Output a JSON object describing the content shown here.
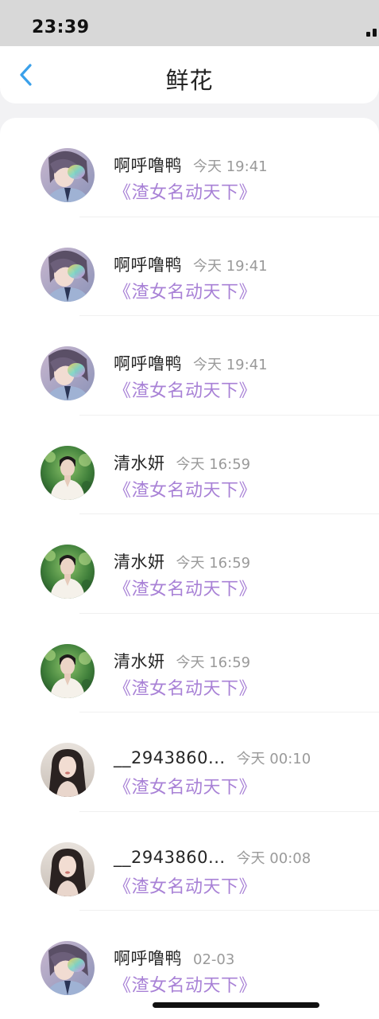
{
  "status_bar": {
    "time": "23:39"
  },
  "header": {
    "title": "鲜花"
  },
  "colors": {
    "accent": "#3aa0ea",
    "book_title": "#a881d6",
    "name": "#262626",
    "time": "#9a9a9a"
  },
  "items": [
    {
      "avatar": "anime-avatar",
      "name": "啊呼噜鸭",
      "time": "今天 19:41",
      "book": "《渣女名动天下》"
    },
    {
      "avatar": "anime-avatar",
      "name": "啊呼噜鸭",
      "time": "今天 19:41",
      "book": "《渣女名动天下》"
    },
    {
      "avatar": "anime-avatar",
      "name": "啊呼噜鸭",
      "time": "今天 19:41",
      "book": "《渣女名动天下》"
    },
    {
      "avatar": "man-photo-avatar",
      "name": "清水妍",
      "time": "今天 16:59",
      "book": "《渣女名动天下》"
    },
    {
      "avatar": "man-photo-avatar",
      "name": "清水妍",
      "time": "今天 16:59",
      "book": "《渣女名动天下》"
    },
    {
      "avatar": "man-photo-avatar",
      "name": "清水妍",
      "time": "今天 16:59",
      "book": "《渣女名动天下》"
    },
    {
      "avatar": "woman-photo-avatar",
      "name": "__2943860...",
      "time": "今天 00:10",
      "book": "《渣女名动天下》"
    },
    {
      "avatar": "woman-photo-avatar",
      "name": "__2943860...",
      "time": "今天 00:08",
      "book": "《渣女名动天下》"
    },
    {
      "avatar": "anime-avatar",
      "name": "啊呼噜鸭",
      "time": "02-03",
      "book": "《渣女名动天下》"
    }
  ]
}
